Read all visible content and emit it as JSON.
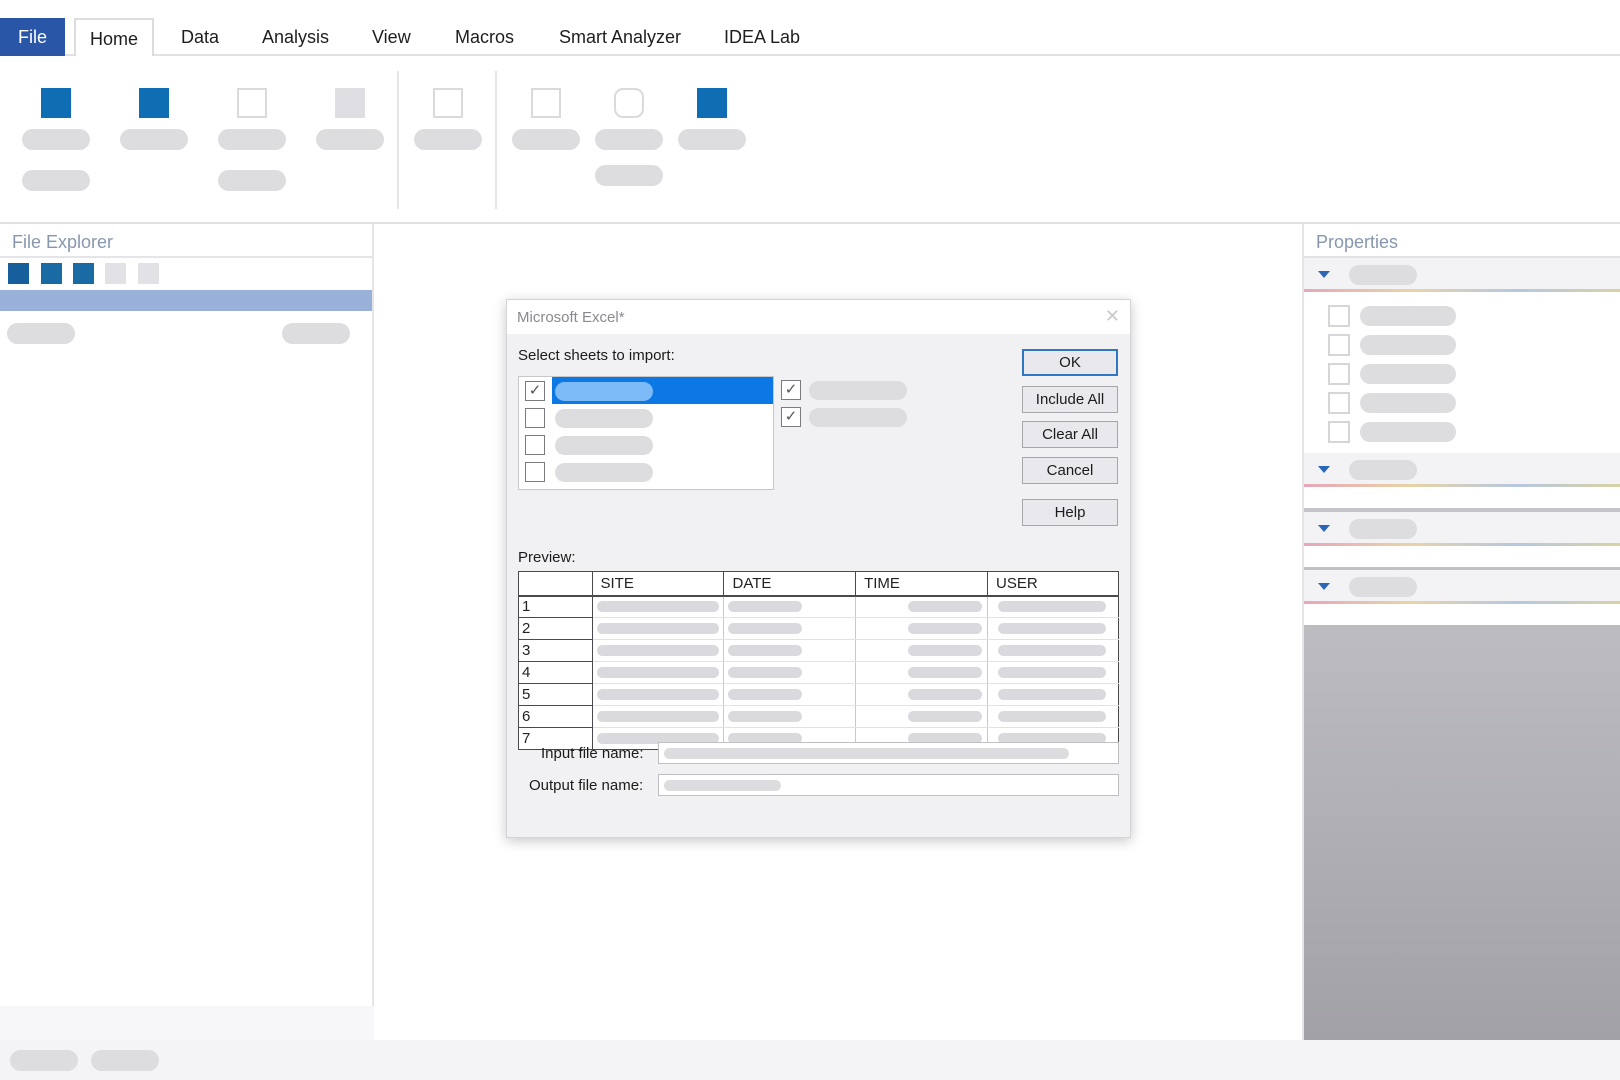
{
  "menu": {
    "tabs": [
      "File",
      "Home",
      "Data",
      "Analysis",
      "View",
      "Macros",
      "Smart Analyzer",
      "IDEA Lab"
    ],
    "active_tab": "Home"
  },
  "left_panel": {
    "title": "File Explorer"
  },
  "right_panel": {
    "title": "Properties"
  },
  "dialog": {
    "title": "Microsoft Excel*",
    "close_icon": "close-icon",
    "select_label": "Select sheets to import:",
    "sheet_checks": [
      true,
      false,
      false,
      false
    ],
    "side_checks": [
      true,
      true
    ],
    "buttons": {
      "ok": "OK",
      "include_all": "Include All",
      "clear_all": "Clear All",
      "cancel": "Cancel",
      "help": "Help"
    },
    "preview_label": "Preview:",
    "preview_columns": [
      "SITE",
      "DATE",
      "TIME",
      "USER"
    ],
    "preview_rows": [
      "1",
      "2",
      "3",
      "4",
      "5",
      "6",
      "7"
    ],
    "input_file_label": "Input file name:",
    "output_file_label": "Output file name:"
  },
  "colors": {
    "accent": "#2a56a8",
    "ribbon_icon": "#0f6db4",
    "selection": "#0b78e3"
  }
}
